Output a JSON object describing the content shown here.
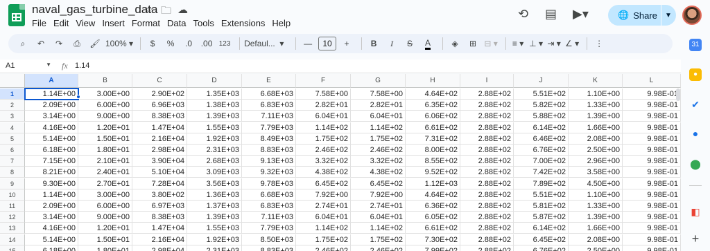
{
  "title": "naval_gas_turbine_data",
  "menu": [
    "File",
    "Edit",
    "View",
    "Insert",
    "Format",
    "Data",
    "Tools",
    "Extensions",
    "Help"
  ],
  "share_label": "Share",
  "toolbar": {
    "zoom": "100%",
    "currency": "$",
    "percent": "%",
    "dec_decrease": ".0",
    "dec_increase": ".00",
    "number_format": "123",
    "font": "Defaul...",
    "font_size": "10",
    "bold": "B",
    "italic": "I",
    "strike": "S",
    "text_color": "A"
  },
  "formula_bar": {
    "cell_ref": "A1",
    "fx": "fx",
    "value": "1.14"
  },
  "columns": [
    "A",
    "B",
    "C",
    "D",
    "E",
    "F",
    "G",
    "H",
    "I",
    "J",
    "K",
    "L"
  ],
  "rows": [
    {
      "n": "1",
      "cells": [
        "1.14E+00",
        "3.00E+00",
        "2.90E+02",
        "1.35E+03",
        "6.68E+03",
        "7.58E+00",
        "7.58E+00",
        "4.64E+02",
        "2.88E+02",
        "5.51E+02",
        "1.10E+00",
        "9.98E-01"
      ]
    },
    {
      "n": "2",
      "cells": [
        "2.09E+00",
        "6.00E+00",
        "6.96E+03",
        "1.38E+03",
        "6.83E+03",
        "2.82E+01",
        "2.82E+01",
        "6.35E+02",
        "2.88E+02",
        "5.82E+02",
        "1.33E+00",
        "9.98E-01"
      ]
    },
    {
      "n": "3",
      "cells": [
        "3.14E+00",
        "9.00E+00",
        "8.38E+03",
        "1.39E+03",
        "7.11E+03",
        "6.04E+01",
        "6.04E+01",
        "6.06E+02",
        "2.88E+02",
        "5.88E+02",
        "1.39E+00",
        "9.98E-01"
      ]
    },
    {
      "n": "4",
      "cells": [
        "4.16E+00",
        "1.20E+01",
        "1.47E+04",
        "1.55E+03",
        "7.79E+03",
        "1.14E+02",
        "1.14E+02",
        "6.61E+02",
        "2.88E+02",
        "6.14E+02",
        "1.66E+00",
        "9.98E-01"
      ]
    },
    {
      "n": "5",
      "cells": [
        "5.14E+00",
        "1.50E+01",
        "2.16E+04",
        "1.92E+03",
        "8.49E+03",
        "1.75E+02",
        "1.75E+02",
        "7.31E+02",
        "2.88E+02",
        "6.46E+02",
        "2.08E+00",
        "9.98E-01"
      ]
    },
    {
      "n": "6",
      "cells": [
        "6.18E+00",
        "1.80E+01",
        "2.98E+04",
        "2.31E+03",
        "8.83E+03",
        "2.46E+02",
        "2.46E+02",
        "8.00E+02",
        "2.88E+02",
        "6.76E+02",
        "2.50E+00",
        "9.98E-01"
      ]
    },
    {
      "n": "7",
      "cells": [
        "7.15E+00",
        "2.10E+01",
        "3.90E+04",
        "2.68E+03",
        "9.13E+03",
        "3.32E+02",
        "3.32E+02",
        "8.55E+02",
        "2.88E+02",
        "7.00E+02",
        "2.96E+00",
        "9.98E-01"
      ]
    },
    {
      "n": "8",
      "cells": [
        "8.21E+00",
        "2.40E+01",
        "5.10E+04",
        "3.09E+03",
        "9.32E+03",
        "4.38E+02",
        "4.38E+02",
        "9.52E+02",
        "2.88E+02",
        "7.42E+02",
        "3.58E+00",
        "9.98E-01"
      ]
    },
    {
      "n": "9",
      "cells": [
        "9.30E+00",
        "2.70E+01",
        "7.28E+04",
        "3.56E+03",
        "9.78E+03",
        "6.45E+02",
        "6.45E+02",
        "1.12E+03",
        "2.88E+02",
        "7.89E+02",
        "4.50E+00",
        "9.98E-01"
      ]
    },
    {
      "n": "10",
      "cells": [
        "1.14E+00",
        "3.00E+00",
        "3.80E+02",
        "1.36E+03",
        "6.68E+03",
        "7.92E+00",
        "7.92E+00",
        "4.64E+02",
        "2.88E+02",
        "5.51E+02",
        "1.10E+00",
        "9.98E-01"
      ]
    },
    {
      "n": "11",
      "cells": [
        "2.09E+00",
        "6.00E+00",
        "6.97E+03",
        "1.37E+03",
        "6.83E+03",
        "2.74E+01",
        "2.74E+01",
        "6.36E+02",
        "2.88E+02",
        "5.81E+02",
        "1.33E+00",
        "9.98E-01"
      ]
    },
    {
      "n": "12",
      "cells": [
        "3.14E+00",
        "9.00E+00",
        "8.38E+03",
        "1.39E+03",
        "7.11E+03",
        "6.04E+01",
        "6.04E+01",
        "6.05E+02",
        "2.88E+02",
        "5.87E+02",
        "1.39E+00",
        "9.98E-01"
      ]
    },
    {
      "n": "13",
      "cells": [
        "4.16E+00",
        "1.20E+01",
        "1.47E+04",
        "1.55E+03",
        "7.79E+03",
        "1.14E+02",
        "1.14E+02",
        "6.61E+02",
        "2.88E+02",
        "6.14E+02",
        "1.66E+00",
        "9.98E-01"
      ]
    },
    {
      "n": "14",
      "cells": [
        "5.14E+00",
        "1.50E+01",
        "2.16E+04",
        "1.92E+03",
        "8.50E+03",
        "1.75E+02",
        "1.75E+02",
        "7.30E+02",
        "2.88E+02",
        "6.45E+02",
        "2.08E+00",
        "9.98E-01"
      ]
    },
    {
      "n": "15",
      "cells": [
        "6.18E+00",
        "1.80E+01",
        "2.98E+04",
        "2.31E+03",
        "8.83E+03",
        "2.46E+02",
        "2.46E+02",
        "7.99E+02",
        "2.88E+02",
        "6.76E+02",
        "2.50E+00",
        "9.98E-01"
      ]
    }
  ],
  "colors": {
    "accent": "#0b57d0",
    "share_bg": "#c2e7ff",
    "toolbar_bg": "#edf2fa",
    "sheets_green": "#0f9d58"
  }
}
